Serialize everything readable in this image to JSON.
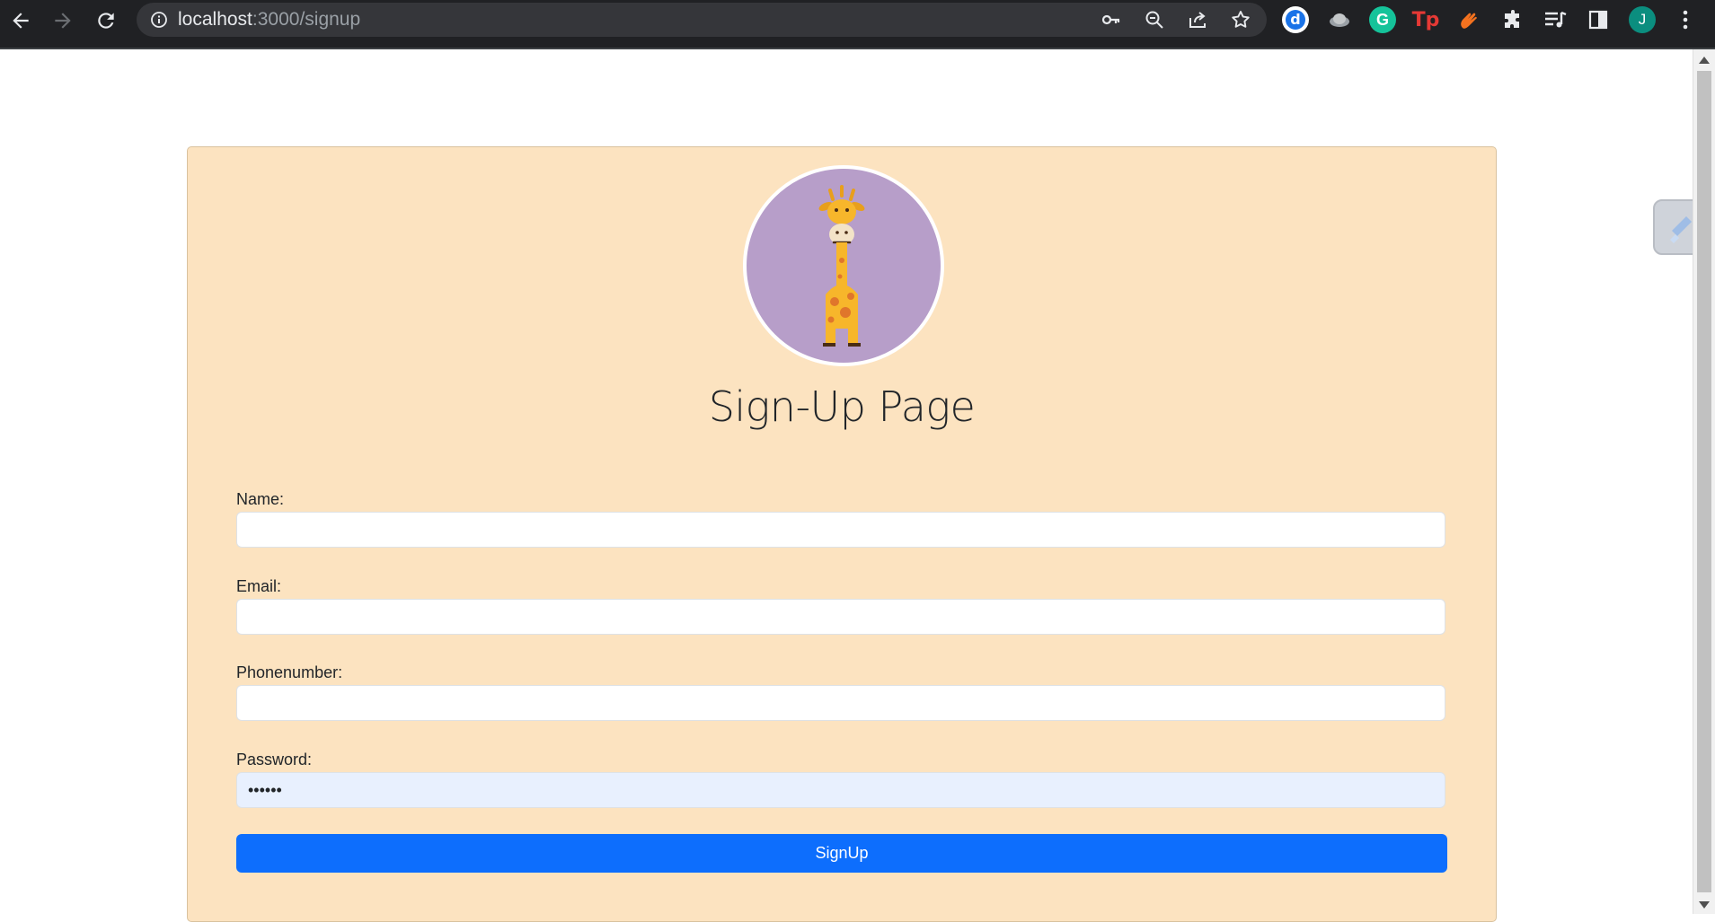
{
  "browser": {
    "url_host": "localhost",
    "url_path": ":3000/signup",
    "profile_initial": "J",
    "extensions": [
      "dictionary-icon",
      "hat-extension-icon",
      "grammarly-icon",
      "tp-extension-icon",
      "clap-extension-icon",
      "puzzle-icon"
    ],
    "colors": {
      "chrome_bg": "#202124",
      "omnibox_bg": "#35363a",
      "profile": "#0b8e7f"
    }
  },
  "page": {
    "title": "Sign-Up Page",
    "avatar_icon": "giraffe-icon",
    "form": {
      "name_label": "Name:",
      "name_value": "",
      "email_label": "Email:",
      "email_value": "",
      "phone_label": "Phonenumber:",
      "phone_value": "",
      "password_label": "Password:",
      "password_value": "••••••",
      "submit_label": "SignUp"
    },
    "colors": {
      "card_bg": "#fce3c0",
      "avatar_bg": "#b79ec9",
      "button_bg": "#0d6efd",
      "autofill_bg": "#e8f0fe"
    }
  }
}
